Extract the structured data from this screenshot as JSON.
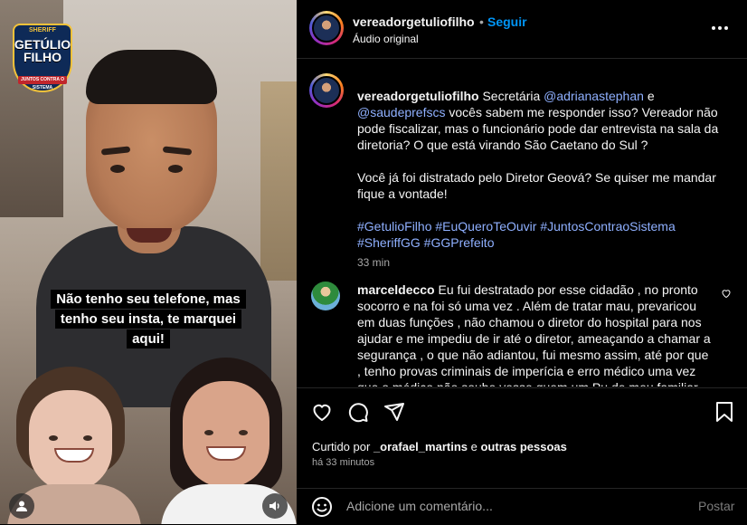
{
  "video": {
    "badge_top": "SHERIFF",
    "badge_name_line1": "GETÚLIO",
    "badge_name_line2": "FILHO",
    "badge_sub": "JUNTOS CONTRA O SISTEMA",
    "caption": "Não tenho seu telefone, mas tenho seu insta, te marquei aqui!",
    "user_icon": "user-icon",
    "audio_icon": "speaker-icon"
  },
  "header": {
    "username": "vereadorgetuliofilho",
    "dot": "•",
    "follow_label": "Seguir",
    "audio_label": "Áudio original",
    "more_icon": "more-icon"
  },
  "post": {
    "username": "vereadorgetuliofilho",
    "text_1": "Secretária",
    "mention_1": "@adrianastephan",
    "text_2": "e",
    "mention_2": "@saudeprefscs",
    "text_3": "vocês sabem me responder isso? Vereador não pode fiscalizar, mas o funcionário pode dar entrevista na sala da diretoria? O que está virando São Caetano do Sul ?",
    "text_4": "Você já foi distratado pelo Diretor Geová? Se quiser me mandar fique a vontade!",
    "hashtags_line1": "#GetulioFilho #EuQueroTeOuvir #JuntosContraoSistema",
    "hashtags_line2": "#SheriffGG #GGPrefeito",
    "time": "33 min"
  },
  "comment": {
    "username": "marceldecco",
    "text": "Eu fui destratado por esse cidadão , no pronto socorro e na foi só uma vez . Além de tratar mau, prevaricou em duas funções , não chamou o diretor do hospital para nos ajudar e me impediu de ir até o diretor, ameaçando a chamar a segurança , o que não adiantou, fui mesmo assim, até por que , tenho provas criminais de imperícia e erro médico uma vez que o médico não soube vesse quem um Pu de meu familiar , que"
  },
  "actions": {
    "like_icon": "heart-icon",
    "comment_icon": "comment-icon",
    "share_icon": "share-icon",
    "save_icon": "bookmark-icon"
  },
  "likes": {
    "prefix": "Curtido por",
    "user": "_orafael_martins",
    "and": "e",
    "others": "outras pessoas",
    "ago": "há 33 minutos"
  },
  "compose": {
    "placeholder": "Adicione um comentário...",
    "post_label": "Postar"
  }
}
